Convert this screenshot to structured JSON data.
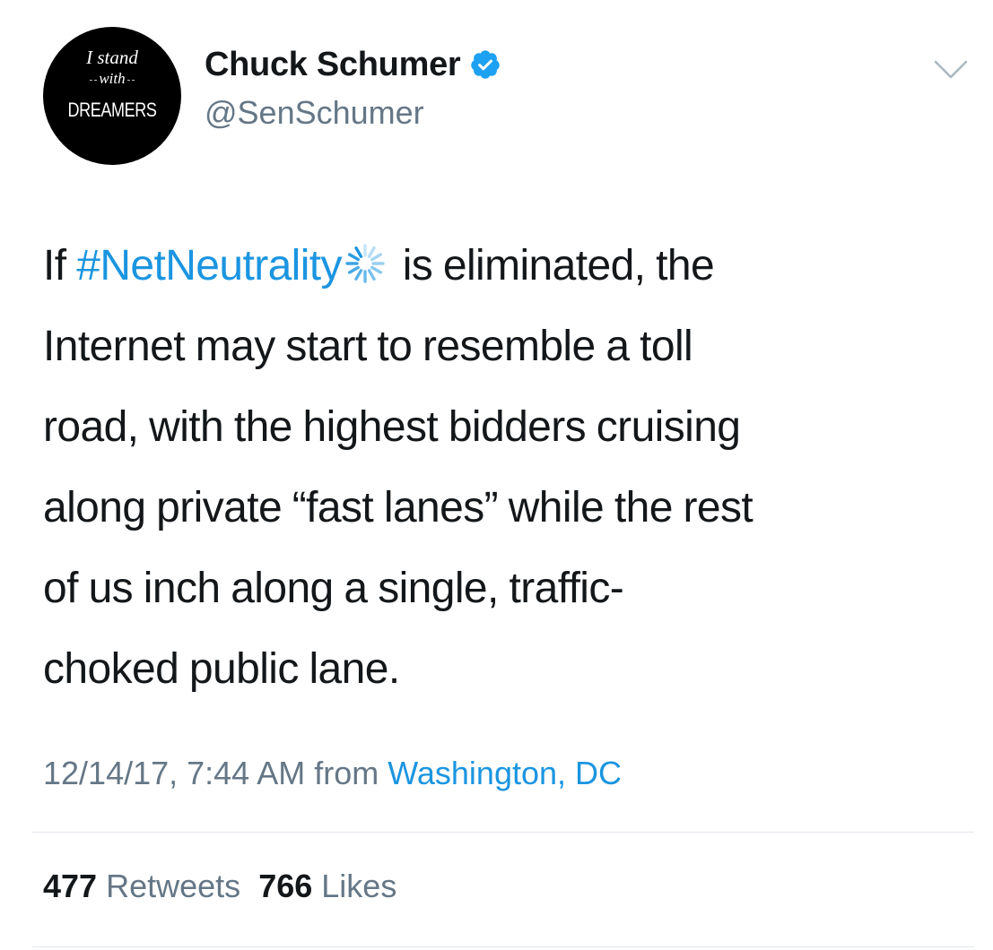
{
  "avatar": {
    "line1": "I stand",
    "line2": "with",
    "line3": "DREAMERS"
  },
  "user": {
    "display_name": "Chuck Schumer",
    "handle": "@SenSchumer",
    "verified": true
  },
  "tweet": {
    "lines": [
      {
        "before": "If ",
        "hashtag": "#NetNeutrality",
        "after": " is eliminated, the"
      },
      {
        "text": "Internet may start to resemble a toll"
      },
      {
        "text": "road, with the highest bidders cruising"
      },
      {
        "text": "along private “fast lanes” while the rest"
      },
      {
        "text": "of us inch along a single, traffic-"
      },
      {
        "text": "choked public lane."
      }
    ],
    "hashtag_icon": "loading-spinner-icon"
  },
  "meta": {
    "timestamp": "12/14/17, 7:44 AM",
    "from": "from",
    "location": "Washington, DC"
  },
  "stats": {
    "retweets_count": "477",
    "retweets_label": "Retweets",
    "likes_count": "766",
    "likes_label": "Likes"
  },
  "colors": {
    "link": "#1b95e0",
    "secondary": "#657786",
    "primary": "#14171a",
    "verified": "#1da1f2"
  }
}
